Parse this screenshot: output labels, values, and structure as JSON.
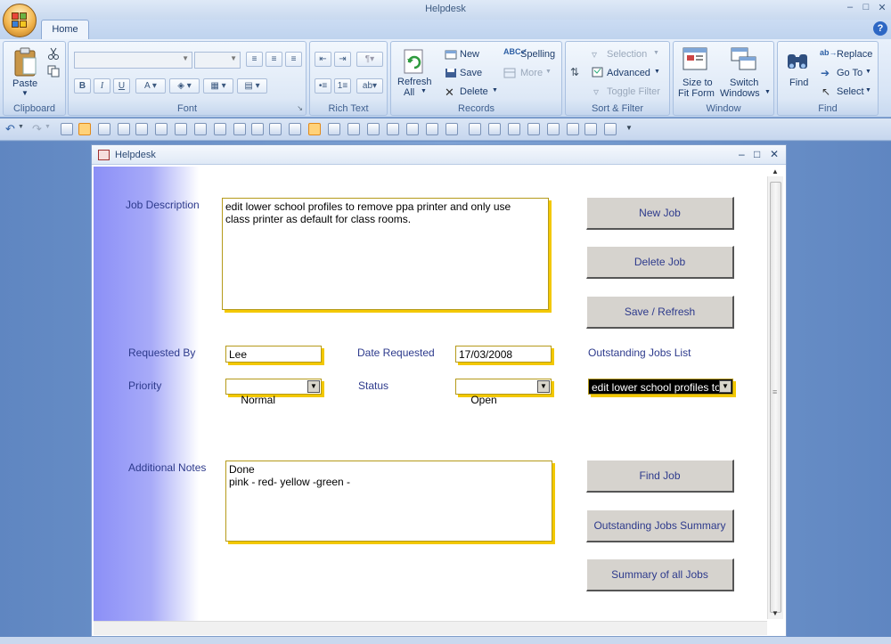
{
  "window": {
    "title": "Helpdesk"
  },
  "ribbon": {
    "tab_home": "Home",
    "clipboard": {
      "paste": "Paste",
      "label": "Clipboard"
    },
    "font": {
      "label": "Font"
    },
    "rich_text": {
      "label": "Rich Text"
    },
    "records": {
      "refresh": "Refresh",
      "refresh_all": "All",
      "new": "New",
      "save": "Save",
      "delete": "Delete",
      "spelling": "Spelling",
      "more": "More",
      "label": "Records"
    },
    "sort_filter": {
      "selection": "Selection",
      "advanced": "Advanced",
      "toggle_filter": "Toggle Filter",
      "label": "Sort & Filter"
    },
    "window": {
      "size_to": "Size to",
      "fit_form": "Fit Form",
      "switch": "Switch",
      "windows": "Windows",
      "label": "Window"
    },
    "find": {
      "find": "Find",
      "replace": "Replace",
      "go_to": "Go To",
      "select": "Select",
      "label": "Find"
    }
  },
  "form": {
    "title": "Helpdesk",
    "job_description_label": "Job Description",
    "job_description_value": "edit lower school profiles to remove ppa printer and only use\nclass printer as default for class rooms.",
    "requested_by_label": "Requested By",
    "requested_by_value": "Lee",
    "date_requested_label": "Date Requested",
    "date_requested_value": "17/03/2008",
    "outstanding_list_label": "Outstanding Jobs List",
    "outstanding_list_value": "edit lower school profiles to",
    "priority_label": "Priority",
    "priority_value": "Normal",
    "status_label": "Status",
    "status_value": "Open",
    "additional_notes_label": "Additional Notes",
    "additional_notes_value": "Done\npink - red- yellow -green -",
    "buttons": {
      "new_job": "New Job",
      "delete_job": "Delete Job",
      "save_refresh": "Save / Refresh",
      "find_job": "Find Job",
      "outstanding_summary": "Outstanding Jobs Summary",
      "summary_all": "Summary of all Jobs"
    }
  },
  "colors": {
    "label_text": "#2d3a8c",
    "field_shadow": "#f3c800",
    "button_face": "#d6d3ce",
    "gradient": "#8b8ff7"
  }
}
